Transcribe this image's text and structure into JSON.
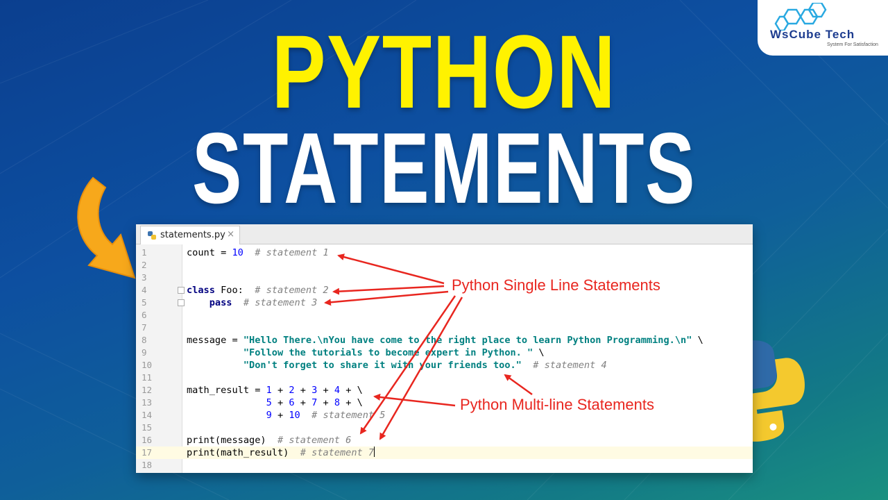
{
  "title": {
    "line1": "PYTHON",
    "line2": "STATEMENTS"
  },
  "logo": {
    "name": "WsCube Tech",
    "tagline": "System For Satisfaction"
  },
  "editor": {
    "tab_label": "statements.py",
    "tab_close": "×",
    "lines": [
      {
        "n": "1"
      },
      {
        "n": "2"
      },
      {
        "n": "3"
      },
      {
        "n": "4"
      },
      {
        "n": "5"
      },
      {
        "n": "6"
      },
      {
        "n": "7"
      },
      {
        "n": "8"
      },
      {
        "n": "9"
      },
      {
        "n": "10"
      },
      {
        "n": "11"
      },
      {
        "n": "12"
      },
      {
        "n": "13"
      },
      {
        "n": "14"
      },
      {
        "n": "15"
      },
      {
        "n": "16"
      },
      {
        "n": "17"
      },
      {
        "n": "18"
      }
    ],
    "code": {
      "l1_a": "count = ",
      "l1_num": "10",
      "l1_cmt": "# statement 1",
      "l4_kw": "class",
      "l4_a": " Foo:  ",
      "l4_cmt": "# statement 2",
      "l5_kw": "pass",
      "l5_cmt": "# statement 3",
      "l8_a": "message = ",
      "l8_str": "\"Hello There.\\nYou have come to the right place to learn Python Programming.\\n\"",
      "l8_b": " \\",
      "l9_str": "\"Follow the tutorials to become expert in Python. \"",
      "l9_b": " \\",
      "l10_str": "\"Don't forget to share it with your friends too.\"",
      "l10_cmt": "# statement 4",
      "l12_a": "math_result = ",
      "l12_n1": "1",
      "l12_n2": "2",
      "l12_n3": "3",
      "l12_n4": "4",
      "l13_n1": "5",
      "l13_n2": "6",
      "l13_n3": "7",
      "l13_n4": "8",
      "l14_n1": "9",
      "l14_n2": "10",
      "l14_cmt": "# statement 5",
      "l16_a": "print(message)",
      "l16_cmt": "# statement 6",
      "l17_a": "print(math_result)",
      "l17_cmt": "# statement 7"
    }
  },
  "annotations": {
    "single": "Python Single Line Statements",
    "multi": "Python Multi-line Statements"
  },
  "colors": {
    "title_yellow": "#fff200",
    "annotation_red": "#e8261f",
    "arrow_orange": "#f7a81b"
  }
}
